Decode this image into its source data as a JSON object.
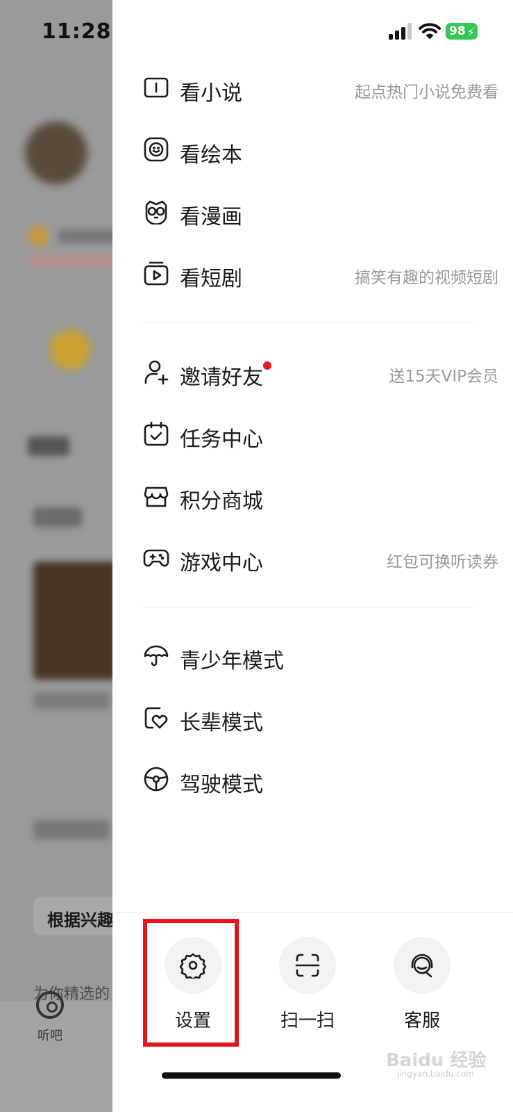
{
  "status_bar": {
    "time": "11:28",
    "battery": "98"
  },
  "background_page": {
    "card_title": "根据兴趣",
    "subtitle": "为你精选的",
    "tab_label": "听吧"
  },
  "drawer": {
    "groups": [
      {
        "items": [
          {
            "label": "看小说",
            "hint": "起点热门小说免费看",
            "icon": "book-icon"
          },
          {
            "label": "看绘本",
            "hint": "",
            "icon": "smiley-face-icon"
          },
          {
            "label": "看漫画",
            "hint": "",
            "icon": "owl-face-icon"
          },
          {
            "label": "看短剧",
            "hint": "搞笑有趣的视频短剧",
            "icon": "video-play-icon"
          }
        ]
      },
      {
        "items": [
          {
            "label": "邀请好友",
            "hint": "送15天VIP会员",
            "icon": "add-user-icon",
            "badge_dot": true
          },
          {
            "label": "任务中心",
            "hint": "",
            "icon": "calendar-check-icon"
          },
          {
            "label": "积分商城",
            "hint": "",
            "icon": "store-icon"
          },
          {
            "label": "游戏中心",
            "hint": "红包可换听读券",
            "icon": "gamepad-icon"
          }
        ]
      },
      {
        "items": [
          {
            "label": "青少年模式",
            "hint": "",
            "icon": "umbrella-icon"
          },
          {
            "label": "长辈模式",
            "hint": "",
            "icon": "heart-card-icon"
          },
          {
            "label": "驾驶模式",
            "hint": "",
            "icon": "steering-wheel-icon"
          }
        ]
      }
    ],
    "actions": [
      {
        "label": "设置",
        "icon": "gear-icon"
      },
      {
        "label": "扫一扫",
        "icon": "scan-icon"
      },
      {
        "label": "客服",
        "icon": "headset-icon"
      }
    ]
  },
  "colors": {
    "highlight_border": "#e8141b",
    "badge_dot": "#e81a1a",
    "battery": "#34c759",
    "hint_text": "#999999"
  },
  "watermark": {
    "text": "Baidu 经验",
    "sub": "jingyan.baidu.com"
  }
}
